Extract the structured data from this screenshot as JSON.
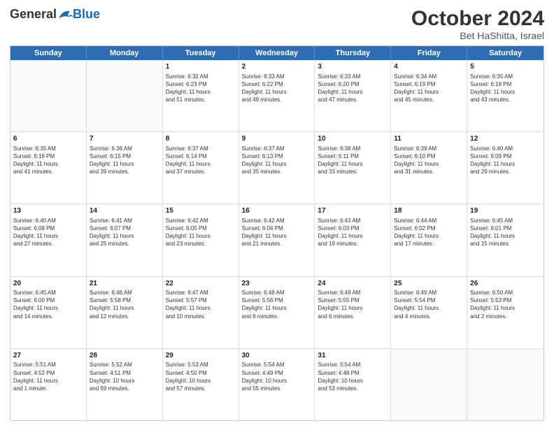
{
  "header": {
    "logo_general": "General",
    "logo_blue": "Blue",
    "month": "October 2024",
    "location": "Bet HaShitta, Israel"
  },
  "days_of_week": [
    "Sunday",
    "Monday",
    "Tuesday",
    "Wednesday",
    "Thursday",
    "Friday",
    "Saturday"
  ],
  "rows": [
    [
      {
        "day": "",
        "empty": true
      },
      {
        "day": "",
        "empty": true
      },
      {
        "day": "1",
        "lines": [
          "Sunrise: 6:32 AM",
          "Sunset: 6:23 PM",
          "Daylight: 11 hours",
          "and 51 minutes."
        ]
      },
      {
        "day": "2",
        "lines": [
          "Sunrise: 6:33 AM",
          "Sunset: 6:22 PM",
          "Daylight: 11 hours",
          "and 49 minutes."
        ]
      },
      {
        "day": "3",
        "lines": [
          "Sunrise: 6:33 AM",
          "Sunset: 6:20 PM",
          "Daylight: 11 hours",
          "and 47 minutes."
        ]
      },
      {
        "day": "4",
        "lines": [
          "Sunrise: 6:34 AM",
          "Sunset: 6:19 PM",
          "Daylight: 11 hours",
          "and 45 minutes."
        ]
      },
      {
        "day": "5",
        "lines": [
          "Sunrise: 6:35 AM",
          "Sunset: 6:18 PM",
          "Daylight: 11 hours",
          "and 43 minutes."
        ]
      }
    ],
    [
      {
        "day": "6",
        "lines": [
          "Sunrise: 6:35 AM",
          "Sunset: 6:16 PM",
          "Daylight: 11 hours",
          "and 41 minutes."
        ]
      },
      {
        "day": "7",
        "lines": [
          "Sunrise: 6:36 AM",
          "Sunset: 6:15 PM",
          "Daylight: 11 hours",
          "and 39 minutes."
        ]
      },
      {
        "day": "8",
        "lines": [
          "Sunrise: 6:37 AM",
          "Sunset: 6:14 PM",
          "Daylight: 11 hours",
          "and 37 minutes."
        ]
      },
      {
        "day": "9",
        "lines": [
          "Sunrise: 6:37 AM",
          "Sunset: 6:13 PM",
          "Daylight: 11 hours",
          "and 35 minutes."
        ]
      },
      {
        "day": "10",
        "lines": [
          "Sunrise: 6:38 AM",
          "Sunset: 6:11 PM",
          "Daylight: 11 hours",
          "and 33 minutes."
        ]
      },
      {
        "day": "11",
        "lines": [
          "Sunrise: 6:39 AM",
          "Sunset: 6:10 PM",
          "Daylight: 11 hours",
          "and 31 minutes."
        ]
      },
      {
        "day": "12",
        "lines": [
          "Sunrise: 6:40 AM",
          "Sunset: 6:09 PM",
          "Daylight: 11 hours",
          "and 29 minutes."
        ]
      }
    ],
    [
      {
        "day": "13",
        "lines": [
          "Sunrise: 6:40 AM",
          "Sunset: 6:08 PM",
          "Daylight: 11 hours",
          "and 27 minutes."
        ]
      },
      {
        "day": "14",
        "lines": [
          "Sunrise: 6:41 AM",
          "Sunset: 6:07 PM",
          "Daylight: 11 hours",
          "and 25 minutes."
        ]
      },
      {
        "day": "15",
        "lines": [
          "Sunrise: 6:42 AM",
          "Sunset: 6:05 PM",
          "Daylight: 11 hours",
          "and 23 minutes."
        ]
      },
      {
        "day": "16",
        "lines": [
          "Sunrise: 6:42 AM",
          "Sunset: 6:04 PM",
          "Daylight: 11 hours",
          "and 21 minutes."
        ]
      },
      {
        "day": "17",
        "lines": [
          "Sunrise: 6:43 AM",
          "Sunset: 6:03 PM",
          "Daylight: 11 hours",
          "and 19 minutes."
        ]
      },
      {
        "day": "18",
        "lines": [
          "Sunrise: 6:44 AM",
          "Sunset: 6:02 PM",
          "Daylight: 11 hours",
          "and 17 minutes."
        ]
      },
      {
        "day": "19",
        "lines": [
          "Sunrise: 6:45 AM",
          "Sunset: 6:01 PM",
          "Daylight: 11 hours",
          "and 15 minutes."
        ]
      }
    ],
    [
      {
        "day": "20",
        "lines": [
          "Sunrise: 6:45 AM",
          "Sunset: 6:00 PM",
          "Daylight: 11 hours",
          "and 14 minutes."
        ]
      },
      {
        "day": "21",
        "lines": [
          "Sunrise: 6:46 AM",
          "Sunset: 5:58 PM",
          "Daylight: 11 hours",
          "and 12 minutes."
        ]
      },
      {
        "day": "22",
        "lines": [
          "Sunrise: 6:47 AM",
          "Sunset: 5:57 PM",
          "Daylight: 11 hours",
          "and 10 minutes."
        ]
      },
      {
        "day": "23",
        "lines": [
          "Sunrise: 6:48 AM",
          "Sunset: 5:56 PM",
          "Daylight: 11 hours",
          "and 8 minutes."
        ]
      },
      {
        "day": "24",
        "lines": [
          "Sunrise: 6:49 AM",
          "Sunset: 5:55 PM",
          "Daylight: 11 hours",
          "and 6 minutes."
        ]
      },
      {
        "day": "25",
        "lines": [
          "Sunrise: 6:49 AM",
          "Sunset: 5:54 PM",
          "Daylight: 11 hours",
          "and 4 minutes."
        ]
      },
      {
        "day": "26",
        "lines": [
          "Sunrise: 6:50 AM",
          "Sunset: 5:53 PM",
          "Daylight: 11 hours",
          "and 2 minutes."
        ]
      }
    ],
    [
      {
        "day": "27",
        "lines": [
          "Sunrise: 5:51 AM",
          "Sunset: 4:52 PM",
          "Daylight: 11 hours",
          "and 1 minute."
        ]
      },
      {
        "day": "28",
        "lines": [
          "Sunrise: 5:52 AM",
          "Sunset: 4:51 PM",
          "Daylight: 10 hours",
          "and 59 minutes."
        ]
      },
      {
        "day": "29",
        "lines": [
          "Sunrise: 5:53 AM",
          "Sunset: 4:50 PM",
          "Daylight: 10 hours",
          "and 57 minutes."
        ]
      },
      {
        "day": "30",
        "lines": [
          "Sunrise: 5:54 AM",
          "Sunset: 4:49 PM",
          "Daylight: 10 hours",
          "and 55 minutes."
        ]
      },
      {
        "day": "31",
        "lines": [
          "Sunrise: 5:54 AM",
          "Sunset: 4:48 PM",
          "Daylight: 10 hours",
          "and 53 minutes."
        ]
      },
      {
        "day": "",
        "empty": true
      },
      {
        "day": "",
        "empty": true
      }
    ]
  ]
}
